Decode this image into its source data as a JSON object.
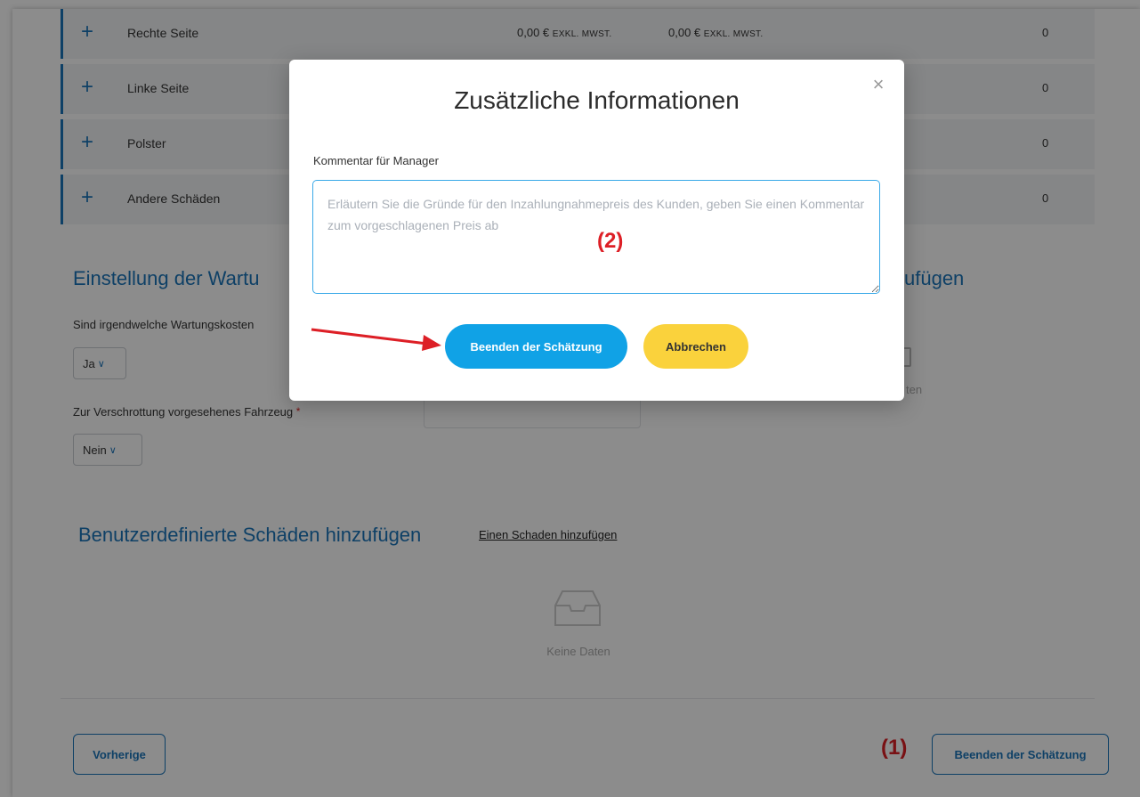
{
  "damage_rows": [
    {
      "name": "Rechte Seite",
      "price1": "0,00 €",
      "price2": "0,00 €",
      "unit": "EXKL. MWST.",
      "count": "0"
    },
    {
      "name": "Linke Seite",
      "count": "0"
    },
    {
      "name": "Polster",
      "count": "0"
    },
    {
      "name": "Andere Schäden",
      "count": "0"
    }
  ],
  "maintenance": {
    "title": "Einstellung der Wartu",
    "question": "Sind irgendwelche Wartungskosten",
    "answer": "Ja"
  },
  "scrap": {
    "label": "Zur Verschrottung vorgesehenes Fahrzeug",
    "required_mark": "*",
    "answer": "Nein"
  },
  "right_section_title_fragment": "ufügen",
  "right_ghost_text": "ten",
  "custom_damages": {
    "title": "Benutzerdefinierte Schäden hinzufügen",
    "add_link": "Einen Schaden hinzufügen",
    "empty_text": "Keine Daten"
  },
  "footer": {
    "previous_label": "Vorherige",
    "finish_label": "Beenden der Schätzung"
  },
  "annotations": {
    "one": "(1)",
    "two": "(2)"
  },
  "modal": {
    "title": "Zusätzliche Informationen",
    "close_glyph": "×",
    "comment_label": "Kommentar für Manager",
    "comment_placeholder": "Erläutern Sie die Gründe für den Inzahlungnahmepreis des Kunden, geben Sie einen Kommentar zum vorgeschlagenen Preis ab",
    "comment_value": "",
    "finish_label": "Beenden der Schätzung",
    "cancel_label": "Abbrechen"
  },
  "colors": {
    "accent_blue": "#1b75bb",
    "primary_button": "#10a2e6",
    "cancel_button": "#fad23c",
    "annotation_red": "#dd1f26"
  }
}
